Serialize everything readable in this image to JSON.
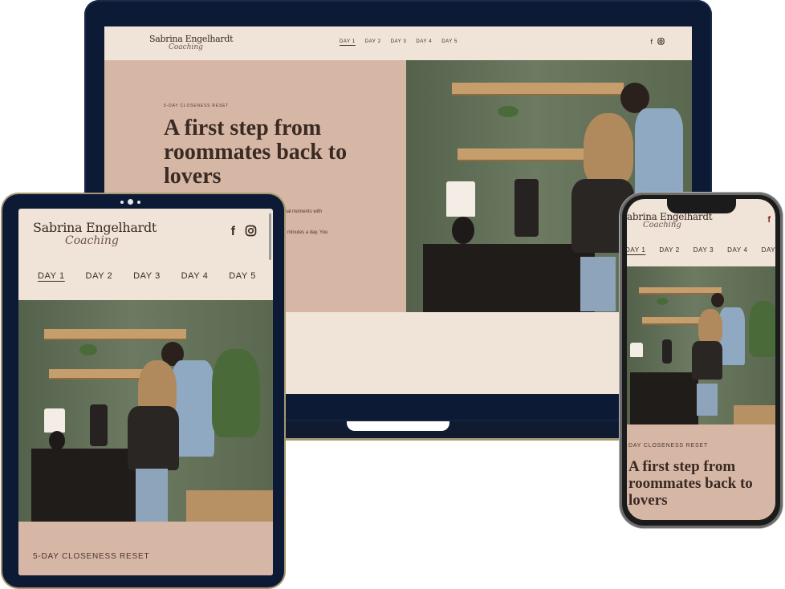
{
  "site": {
    "logo_name": "Sabrina Engelhardt",
    "logo_script": "Coaching",
    "nav": [
      "DAY 1",
      "DAY 2",
      "DAY 3",
      "DAY 4",
      "DAY 5"
    ],
    "active_nav": "DAY 1",
    "eyebrow": "5-DAY CLOSENESS RESET",
    "headline": "A first step from roommates back to lovers",
    "body_fragments": [
      "d intentional moments with",
      "ust 10–15 minutes a day. You"
    ],
    "social_icons": [
      "facebook-icon",
      "instagram-icon"
    ]
  },
  "phone": {
    "nav": [
      "DAY 1",
      "DAY 2",
      "DAY 3",
      "DAY 4",
      "DAY"
    ],
    "logo_name": "abrina Engelhardt",
    "eyebrow": "DAY CLOSENESS RESET",
    "headline": "A first step from roommates back to lovers"
  },
  "colors": {
    "navy": "#0c1a36",
    "cream": "#f0e3d8",
    "blush": "#d6b7a5",
    "gold_trim": "#a79872"
  }
}
